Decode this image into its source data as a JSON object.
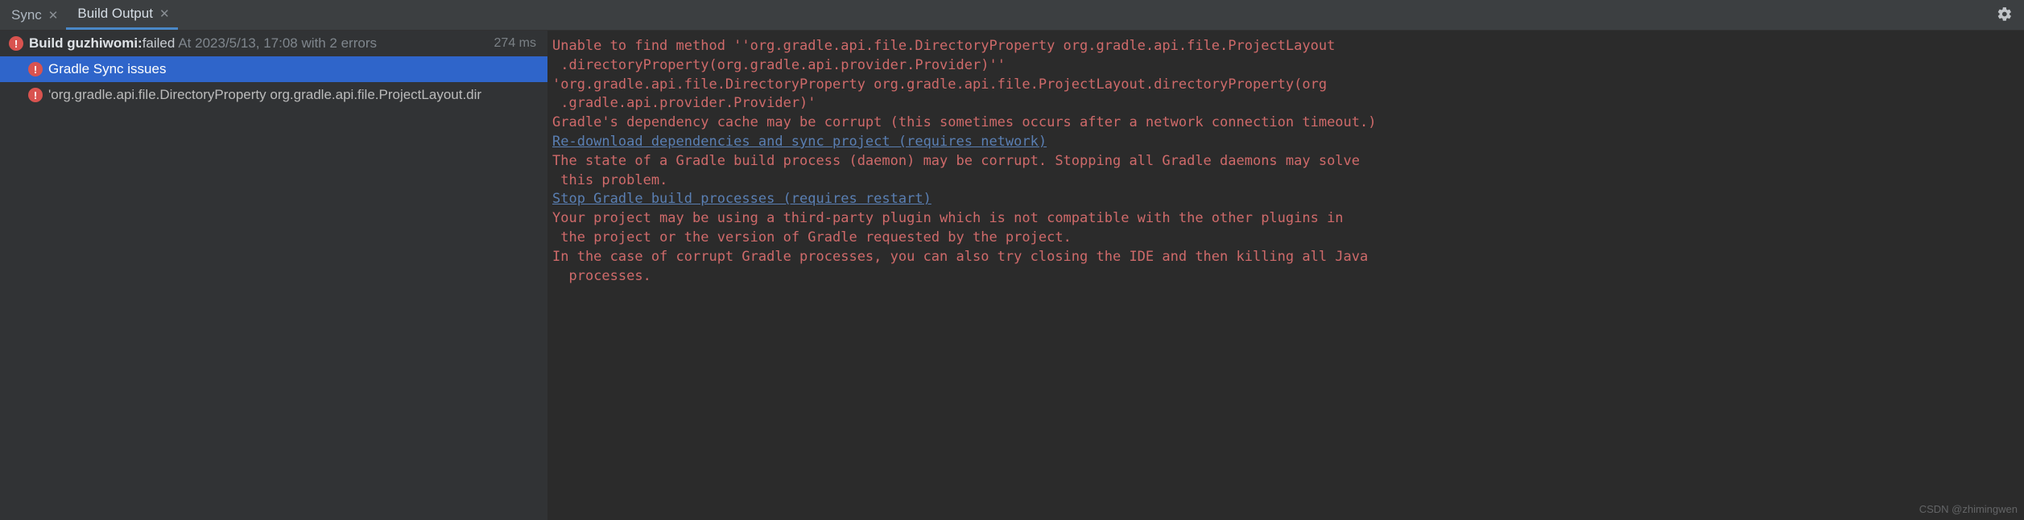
{
  "tabs": {
    "items": [
      {
        "label": "Sync",
        "active": false
      },
      {
        "label": "Build Output",
        "active": true
      }
    ]
  },
  "tree": {
    "build": {
      "prefix": "Build ",
      "project": "guzhiwomi:",
      "status": " failed",
      "meta": "At 2023/5/13, 17:08 with 2 errors",
      "timing": "274 ms"
    },
    "issue1": {
      "label": "Gradle Sync issues"
    },
    "issue2": {
      "label": "'org.gradle.api.file.DirectoryProperty org.gradle.api.file.ProjectLayout.dir"
    }
  },
  "console": {
    "l1": "Unable to find method ''org.gradle.api.file.DirectoryProperty org.gradle.api.file.ProjectLayout",
    "l2": " .directoryProperty(org.gradle.api.provider.Provider)''",
    "l3": "'org.gradle.api.file.DirectoryProperty org.gradle.api.file.ProjectLayout.directoryProperty(org",
    "l4": " .gradle.api.provider.Provider)'",
    "l5": "",
    "l6": "Gradle's dependency cache may be corrupt (this sometimes occurs after a network connection timeout.)",
    "l7": "",
    "link1": "Re-download dependencies and sync project (requires network)",
    "l8": "The state of a Gradle build process (daemon) may be corrupt. Stopping all Gradle daemons may solve",
    "l9": " this problem.",
    "l10": "",
    "link2": "Stop Gradle build processes (requires restart)",
    "l11": "Your project may be using a third-party plugin which is not compatible with the other plugins in",
    "l12": " the project or the version of Gradle requested by the project.",
    "l13": "",
    "l14": "In the case of corrupt Gradle processes, you can also try closing the IDE and then killing all Java",
    "l15": "  processes."
  },
  "watermark": "CSDN @zhimingwen"
}
